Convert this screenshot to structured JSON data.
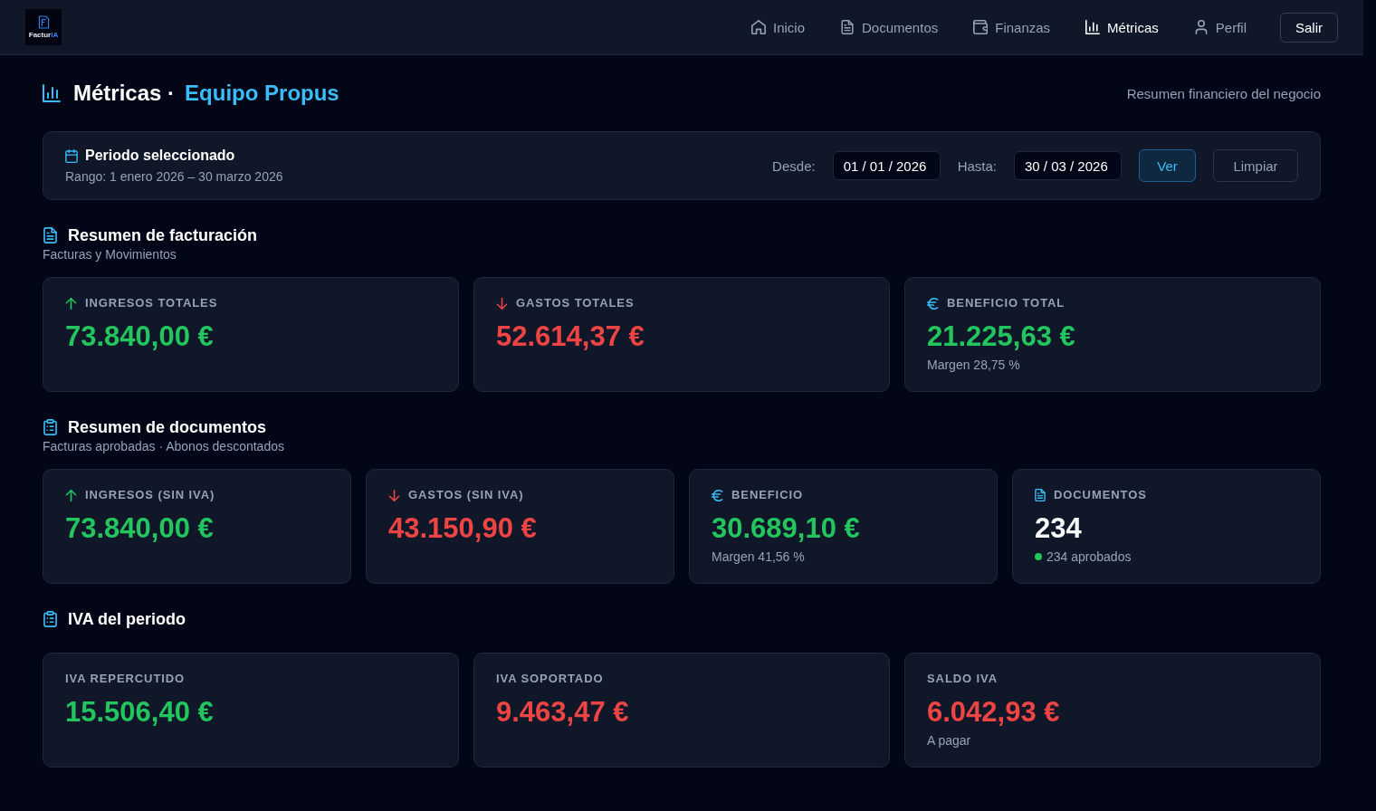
{
  "nav": {
    "logo": {
      "text": "Factur",
      "accent": "IA"
    },
    "items": [
      {
        "kind": "home",
        "label": "Inicio",
        "selected": false
      },
      {
        "kind": "documents",
        "label": "Documentos",
        "selected": false
      },
      {
        "kind": "finance",
        "label": "Finanzas",
        "selected": false
      },
      {
        "kind": "metrics",
        "label": "Métricas",
        "selected": true
      },
      {
        "kind": "profile",
        "label": "Perfil",
        "selected": false
      }
    ],
    "logout": "Salir"
  },
  "header": {
    "title": "Métricas ·",
    "team": "Equipo Propus",
    "subtitle": "Resumen financiero del negocio"
  },
  "period": {
    "title": "Periodo seleccionado",
    "range": "Rango: 1 enero 2026 – 30 marzo 2026",
    "from_label": "Desde:",
    "from_value": "01 / 01 / 2026",
    "to_label": "Hasta:",
    "to_value": "30 / 03 / 2026",
    "buttons": [
      {
        "kind": "primary",
        "label": "Ver"
      },
      {
        "kind": "secondary",
        "label": "Limpiar"
      }
    ]
  },
  "sections": [
    {
      "kind": "billing",
      "title": "Resumen de facturación",
      "subtitle": "Facturas y Movimientos",
      "cards": [
        {
          "kind": "income",
          "label": "INGRESOS TOTALES",
          "value": "73.840,00 €",
          "color": "#22c55e"
        },
        {
          "kind": "expense",
          "label": "GASTOS TOTALES",
          "value": "52.614,37 €",
          "color": "#ef4444"
        },
        {
          "kind": "profit",
          "label": "BENEFICIO TOTAL",
          "value": "21.225,63 €",
          "color": "#22c55e",
          "note": "Margen 28,75 %"
        }
      ]
    },
    {
      "kind": "documents",
      "title": "Resumen de documentos",
      "subtitle": "Facturas aprobadas · Abonos descontados",
      "cards": [
        {
          "kind": "income",
          "label": "INGRESOS (SIN IVA)",
          "value": "73.840,00 €",
          "color": "#22c55e"
        },
        {
          "kind": "expense",
          "label": "GASTOS (SIN IVA)",
          "value": "43.150,90 €",
          "color": "#ef4444"
        },
        {
          "kind": "profit",
          "label": "BENEFICIO",
          "value": "30.689,10 €",
          "color": "#22c55e",
          "note": "Margen 41,56 %"
        },
        {
          "kind": "count",
          "label": "DOCUMENTOS",
          "value": "234",
          "color": "#f8fafc",
          "note": "234 aprobados",
          "dot": {
            "color": "#22c55e"
          }
        }
      ]
    },
    {
      "kind": "vat",
      "title": "IVA del periodo",
      "cards": [
        {
          "kind": "plain",
          "label": "IVA REPERCUTIDO",
          "value": "15.506,40 €",
          "color": "#22c55e"
        },
        {
          "kind": "plain",
          "label": "IVA SOPORTADO",
          "value": "9.463,47 €",
          "color": "#ef4444"
        },
        {
          "kind": "plain",
          "label": "SALDO IVA",
          "value": "6.042,93 €",
          "color": "#ef4444",
          "note": "A pagar"
        }
      ]
    }
  ]
}
